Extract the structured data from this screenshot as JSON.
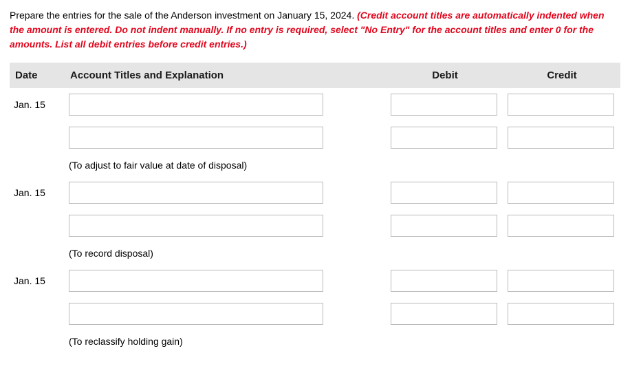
{
  "prompt": {
    "black": "Prepare the entries for the sale of the Anderson investment on January 15, 2024. ",
    "red": "(Credit account titles are automatically indented when the amount is entered. Do not indent manually. If no entry is required, select \"No Entry\" for the account titles and enter 0 for the amounts. List all debit entries before credit entries.)"
  },
  "headers": {
    "date": "Date",
    "account": "Account Titles and Explanation",
    "debit": "Debit",
    "credit": "Credit"
  },
  "rows": [
    {
      "date": "Jan. 15",
      "account": "",
      "debit": "",
      "credit": ""
    },
    {
      "date": "",
      "account": "",
      "debit": "",
      "credit": ""
    },
    {
      "explanation": "(To adjust to fair value at date of disposal)"
    },
    {
      "date": "Jan. 15",
      "account": "",
      "debit": "",
      "credit": ""
    },
    {
      "date": "",
      "account": "",
      "debit": "",
      "credit": ""
    },
    {
      "explanation": "(To record disposal)"
    },
    {
      "date": "Jan. 15",
      "account": "",
      "debit": "",
      "credit": ""
    },
    {
      "date": "",
      "account": "",
      "debit": "",
      "credit": ""
    },
    {
      "explanation": "(To reclassify holding gain)"
    }
  ]
}
